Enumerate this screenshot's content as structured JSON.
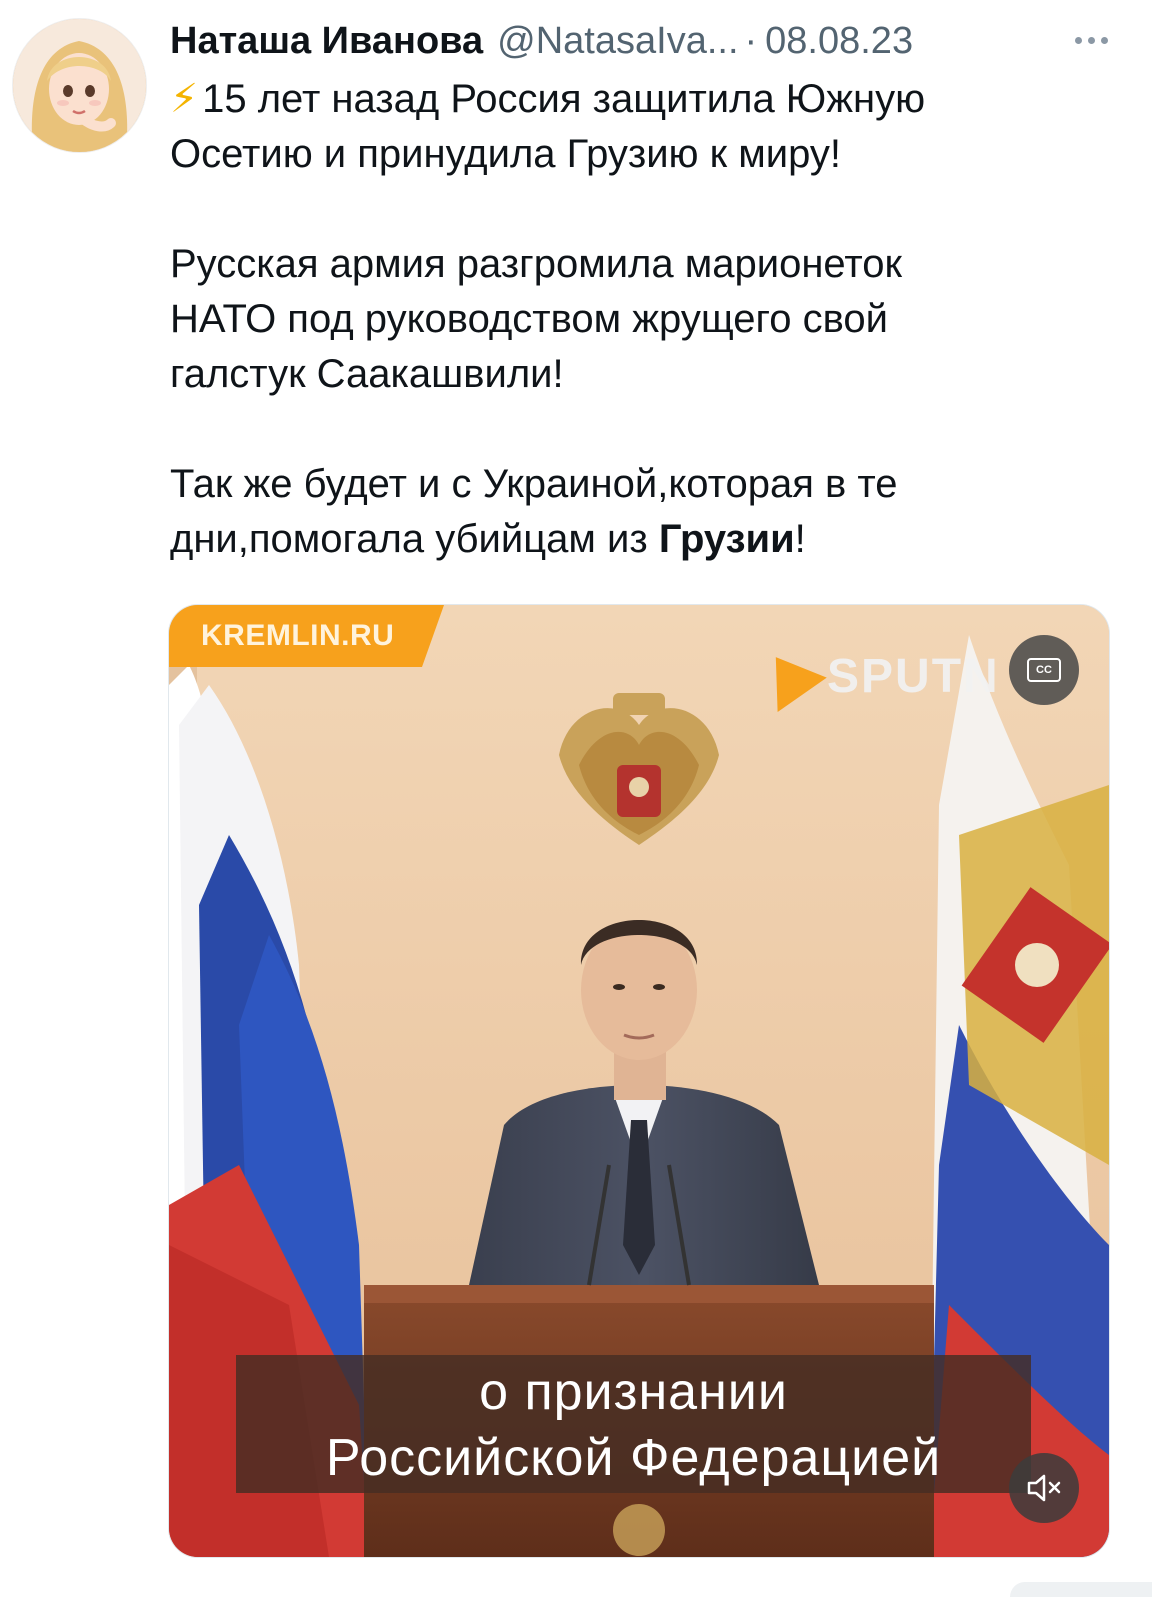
{
  "tweet": {
    "author_name": "Наташа Иванова",
    "author_handle": "@NatasaIva...",
    "separator": "·",
    "date": "08.08.23",
    "more_icon": "more-dots-icon",
    "avatar_icon": "avatar-anime-girl",
    "paragraphs": {
      "p1_emoji": "⚡",
      "p1_line1": "15 лет назад Россия защитила Южную",
      "p1_line2": "Осетию и принудила Грузию к миру!",
      "p2_line1": "Русская армия разгромила марионеток",
      "p2_line2": "НАТО под руководством жрущего свой",
      "p2_line3": "галстук Саакашвили!",
      "p3_line1": "Так же будет и с Украиной,которая в те",
      "p3_line2_prefix": "дни,помогала убийцам из ",
      "p3_line2_bold": "Грузии",
      "p3_line2_suffix": "!"
    }
  },
  "video": {
    "source_badge": "KREMLIN.RU",
    "brand_watermark": "SPUTN",
    "cc_label": "CC",
    "subtitle_line1": "о признании",
    "subtitle_line2": "Российской Федерацией",
    "mute_icon": "speaker-muted-icon",
    "cc_icon": "closed-captions-icon",
    "accent_color": "#f7a11c"
  }
}
